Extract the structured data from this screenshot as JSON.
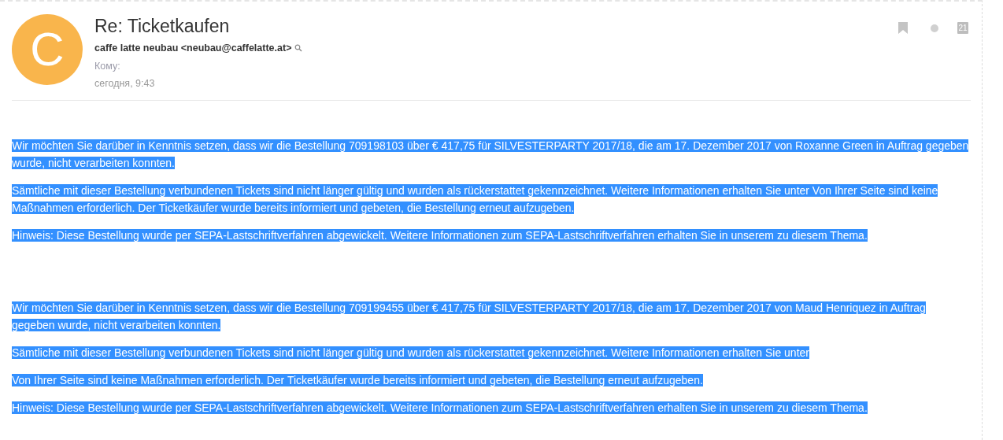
{
  "avatar": {
    "letter": "C",
    "color": "#f9b54c"
  },
  "subject": "Re: Ticketkaufen",
  "sender": "caffe latte neubau <neubau@caffelatte.at>",
  "to_label": "Кому:",
  "date": "сегодня, 9:43",
  "calendar_day": "21",
  "sections": [
    {
      "paragraphs": [
        {
          "text": "Wir möchten Sie darüber in Kenntnis setzen, dass wir die Bestellung 709198103 über € 417,75 für SILVESTERPARTY 2017/18, die am 17. Dezember 2017 von Roxanne Green in Auftrag gegeben wurde, nicht verarbeiten konnten.",
          "highlighted": true
        },
        {
          "text": "Sämtliche mit dieser Bestellung verbundenen Tickets sind nicht länger gültig und wurden als rückerstattet gekennzeichnet. Weitere Informationen erhalten Sie unter Von Ihrer Seite sind keine Maßnahmen erforderlich. Der Ticketkäufer wurde bereits informiert und gebeten, die Bestellung erneut aufzugeben.",
          "highlighted": true
        },
        {
          "text": "Hinweis: Diese Bestellung wurde per SEPA-Lastschriftverfahren abgewickelt. Weitere Informationen zum SEPA-Lastschriftverfahren erhalten Sie in unserem zu diesem Thema.",
          "highlighted": true
        }
      ]
    },
    {
      "paragraphs": [
        {
          "text": "Wir möchten Sie darüber in Kenntnis setzen, dass wir die Bestellung 709199455 über € 417,75 für SILVESTERPARTY 2017/18, die am 17. Dezember 2017 von Maud Henriquez in Auftrag gegeben wurde, nicht verarbeiten konnten.",
          "highlighted": true
        },
        {
          "text": "Sämtliche mit dieser Bestellung verbundenen Tickets sind nicht länger gültig und wurden als rückerstattet gekennzeichnet. Weitere Informationen erhalten Sie unter",
          "highlighted": true
        },
        {
          "text": "Von Ihrer Seite sind keine Maßnahmen erforderlich. Der Ticketkäufer wurde bereits informiert und gebeten, die Bestellung erneut aufzugeben.",
          "highlighted": true
        },
        {
          "text": "Hinweis: Diese Bestellung wurde per SEPA-Lastschriftverfahren abgewickelt. Weitere Informationen zum SEPA-Lastschriftverfahren erhalten Sie in unserem zu diesem Thema.",
          "highlighted": true
        }
      ]
    }
  ]
}
